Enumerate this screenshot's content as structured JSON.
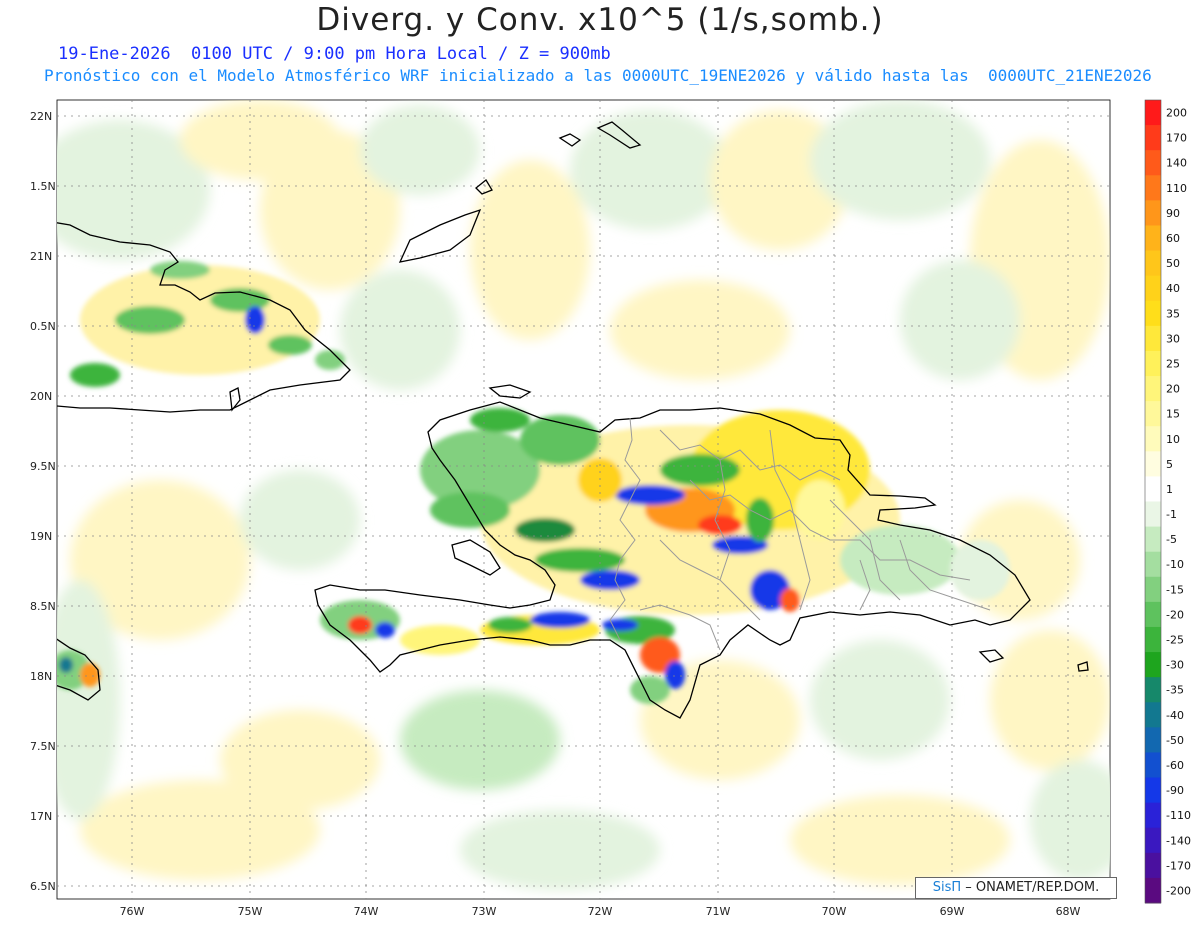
{
  "header": {
    "title": "Diverg. y Conv. x10^5 (1/s,somb.)",
    "subtitle_line1": "19-Ene-2026  0100 UTC / 9:00 pm Hora Local / Z = 900mb",
    "subtitle_line2": "Pronóstico con el Modelo Atmosférico WRF inicializado a las 0000UTC_19ENE2026 y válido hasta las  0000UTC_21ENE2026"
  },
  "map": {
    "lat_labels": [
      "22N",
      "1.5N",
      "21N",
      "0.5N",
      "20N",
      "9.5N",
      "19N",
      "8.5N",
      "18N",
      "7.5N",
      "17N",
      "6.5N"
    ],
    "lon_labels": [
      "76W",
      "75W",
      "74W",
      "73W",
      "72W",
      "71W",
      "70W",
      "69W",
      "68W"
    ]
  },
  "colorbar": {
    "labels": [
      "200",
      "170",
      "140",
      "110",
      "90",
      "60",
      "50",
      "40",
      "35",
      "30",
      "25",
      "20",
      "15",
      "10",
      "5",
      "1",
      "-1",
      "-5",
      "-10",
      "-15",
      "-20",
      "-25",
      "-30",
      "-35",
      "-40",
      "-50",
      "-60",
      "-90",
      "-110",
      "-140",
      "-170",
      "-200"
    ],
    "colors": [
      "#ff1a1a",
      "#ff3b1a",
      "#ff5a1a",
      "#ff781a",
      "#ff961a",
      "#ffb31a",
      "#ffc61a",
      "#ffd21a",
      "#ffde1a",
      "#ffe83a",
      "#fff15a",
      "#fff57a",
      "#fff89a",
      "#fffbbb",
      "#fffde0",
      "#ffffff",
      "#eaf6e6",
      "#c6ebc0",
      "#a4dea0",
      "#82d07f",
      "#5ec25e",
      "#3cb43c",
      "#1ea51e",
      "#16886a",
      "#127890",
      "#1268b0",
      "#1250d0",
      "#1438e8",
      "#2a22d8",
      "#3a18c0",
      "#4a109f",
      "#5a0a80"
    ]
  },
  "credit": {
    "logo": "SisΠ",
    "text": " – ONAMET/REP.DOM."
  },
  "colors": {
    "title": "#222222",
    "subtitle1": "#1a2fff",
    "subtitle2": "#1a8cff",
    "coastline": "#000000",
    "borders": "#9a9a9a"
  }
}
